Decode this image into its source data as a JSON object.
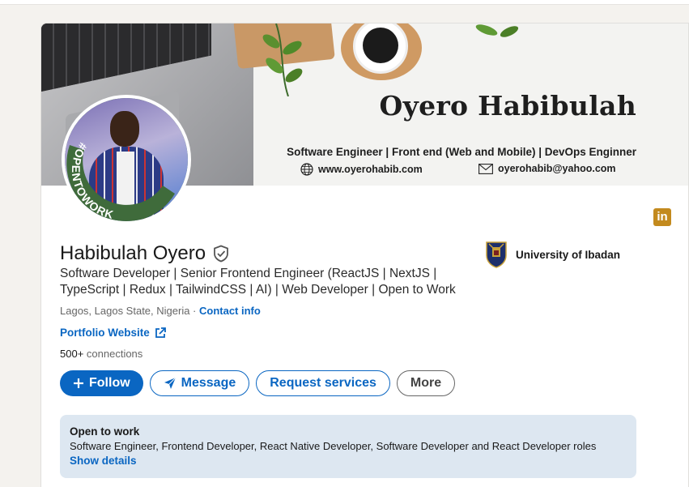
{
  "banner": {
    "name": "Oyero Habibulah",
    "tagline": "Software Engineer | Front end (Web and Mobile) | DevOps Enginner",
    "website": "www.oyerohabib.com",
    "email": "oyerohabib@yahoo.com"
  },
  "avatar": {
    "badge_text": "#OPENTOWORK"
  },
  "profile": {
    "name": "Habibulah Oyero",
    "headline": "Software Developer | Senior Frontend Engineer (ReactJS | NextJS | TypeScript | Redux | TailwindCSS | AI) | Web Developer | Open to Work",
    "location": "Lagos, Lagos State, Nigeria",
    "location_sep": " · ",
    "contact_info": "Contact info",
    "portfolio": "Portfolio Website",
    "connections_count": "500+",
    "connections_label": " connections"
  },
  "education": {
    "school": "University of Ibadan"
  },
  "actions": {
    "follow": "Follow",
    "message": "Message",
    "request_services": "Request services",
    "more": "More"
  },
  "open_to_work": {
    "title": "Open to work",
    "roles": "Software Engineer, Frontend Developer, React Native Developer, Software Developer and React Developer roles",
    "show_details": "Show details"
  },
  "colors": {
    "primary": "#0a66c2",
    "otw_green": "#3f6b3b",
    "otw_bg": "#dde7f1"
  },
  "icons": [
    "globe-icon",
    "mail-icon",
    "verified-shield-icon",
    "external-link-icon",
    "plus-icon",
    "send-icon",
    "linkedin-icon",
    "university-crest-icon"
  ]
}
